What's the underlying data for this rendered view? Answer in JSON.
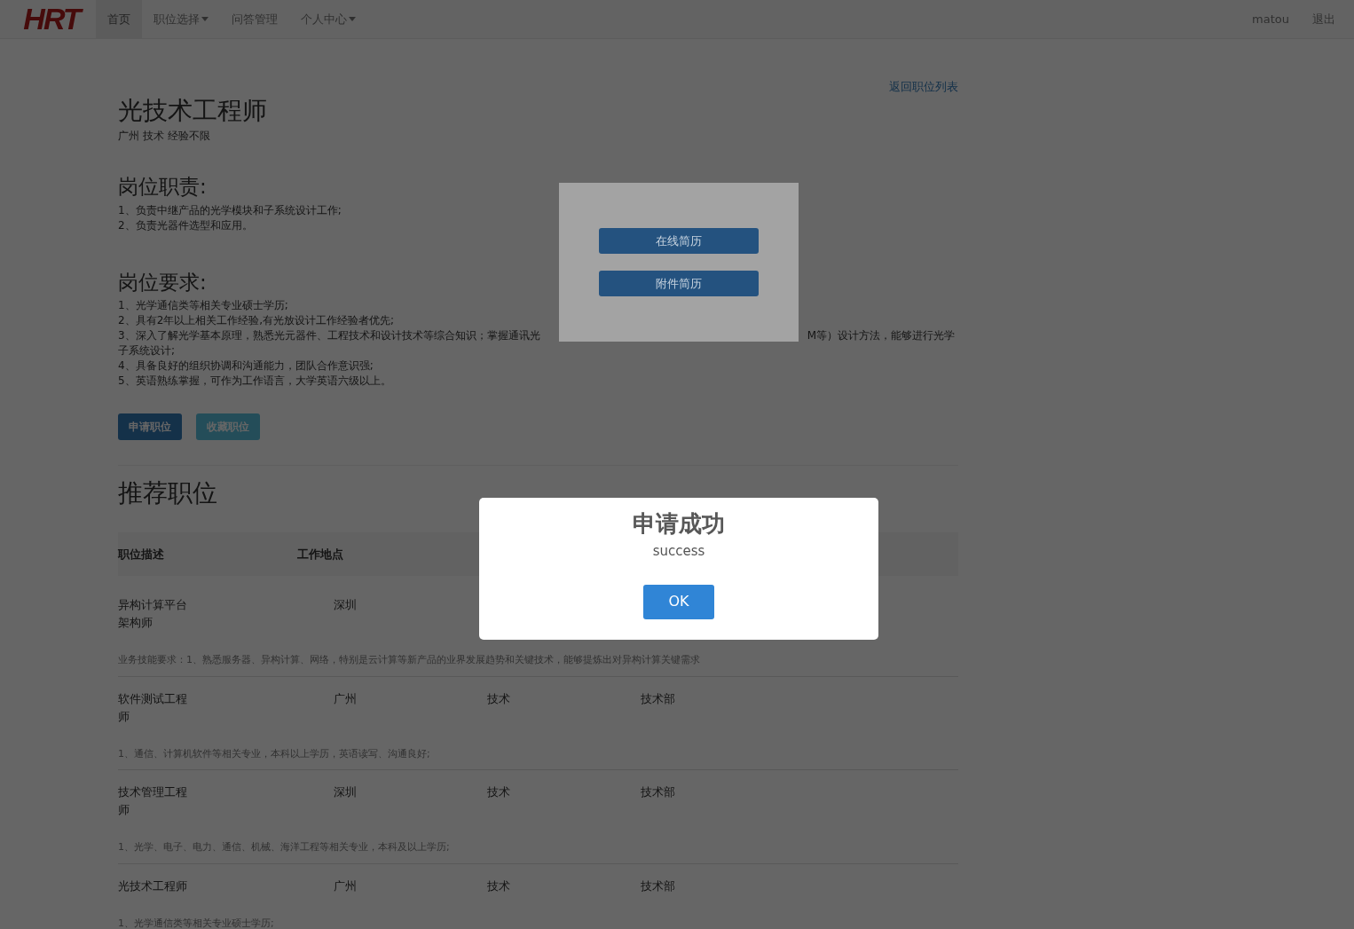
{
  "navbar": {
    "logo": "HRT",
    "items": [
      {
        "label": "首页",
        "selected": true,
        "dropdown": false
      },
      {
        "label": "职位选择",
        "selected": false,
        "dropdown": true
      },
      {
        "label": "问答管理",
        "selected": false,
        "dropdown": false
      },
      {
        "label": "个人中心",
        "selected": false,
        "dropdown": true
      }
    ],
    "user": "matou",
    "logout": "退出"
  },
  "back_link": "返回职位列表",
  "job": {
    "title": "光技术工程师",
    "meta": "广州 技术 经验不限",
    "sections": [
      {
        "heading": "岗位职责:",
        "items": [
          {
            "kind": "line",
            "text": "1、负责中继产品的光学模块和子系统设计工作;"
          },
          {
            "kind": "line",
            "text": "2、负责光器件选型和应用。"
          }
        ]
      },
      {
        "heading": "岗位要求:",
        "items": [
          {
            "kind": "line",
            "text": "1、光学通信类等相关专业硕士学历;"
          },
          {
            "kind": "line",
            "text": "2、具有2年以上相关工作经验,有光放设计工作经验者优先;"
          },
          {
            "kind": "covered",
            "before": "3、深入了解光学基本原理，熟悉光元器件、工程技术和设计技术等综合知识；掌握通讯光",
            "after": "M等）设计方法，能够进行光学",
            "rest": "子系统设计;"
          },
          {
            "kind": "line",
            "text": "4、具备良好的组织协调和沟通能力，团队合作意识强;"
          },
          {
            "kind": "line",
            "text": "5、英语熟练掌握，可作为工作语言，大学英语六级以上。"
          }
        ]
      }
    ]
  },
  "actions": [
    {
      "label": "申请职位",
      "kind": "primary"
    },
    {
      "label": "收藏职位",
      "kind": "info"
    }
  ],
  "recommended": {
    "title": "推荐职位",
    "columns": [
      "职位描述",
      "工作地点"
    ],
    "rows": [
      {
        "cells": [
          "异构计算平台架构师",
          "深圳"
        ],
        "description": "业务技能要求：1、熟悉服务器、异构计算、网络，特别是云计算等新产品的业界发展趋势和关键技术，能够提炼出对异构计算关键需求"
      },
      {
        "cells": [
          "软件测试工程师",
          "广州",
          "技术",
          "技术部"
        ],
        "description": "1、通信、计算机软件等相关专业，本科以上学历，英语读写、沟通良好;"
      },
      {
        "cells": [
          "技术管理工程师",
          "深圳",
          "技术",
          "技术部"
        ],
        "description": "1、光学、电子、电力、通信、机械、海洋工程等相关专业，本科及以上学历;"
      },
      {
        "cells": [
          "光技术工程师",
          "广州",
          "技术",
          "技术部"
        ],
        "description": "1、光学通信类等相关专业硕士学历;"
      }
    ]
  },
  "resume_popup": {
    "buttons": [
      "在线简历",
      "附件简历"
    ]
  },
  "alert": {
    "title": "申请成功",
    "text": "success",
    "button": "OK"
  }
}
